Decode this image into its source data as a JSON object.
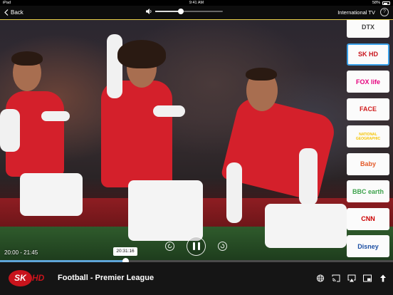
{
  "status_bar": {
    "left": "iPad",
    "time": "9:41 AM",
    "battery": "58%"
  },
  "top_bar": {
    "back_label": "Back",
    "volume_level": 0.38,
    "title": "International TV",
    "help_label": "?"
  },
  "player": {
    "elapsed_time": "20:00 - 21:45",
    "scrub_tooltip": "20:31:16",
    "progress": 0.32,
    "rewind_icon": "rewind-icon",
    "pause_icon": "pause-icon",
    "forward_icon": "forward-icon"
  },
  "channels": [
    {
      "name": "DTX",
      "color": "#444444"
    },
    {
      "name": "SK HD",
      "color": "#c8141c",
      "active": true
    },
    {
      "name": "FOX life",
      "color": "#e6007e"
    },
    {
      "name": "FACE",
      "color": "#d01d1d"
    },
    {
      "name": "NATIONAL GEOGRAPHIC",
      "color": "#f5c400"
    },
    {
      "name": "Baby",
      "color": "#e45b2a"
    },
    {
      "name": "BBC earth",
      "color": "#3fa34d"
    },
    {
      "name": "CNN",
      "color": "#cc0000"
    },
    {
      "name": "Disney",
      "color": "#1c4fa3"
    }
  ],
  "bottom_bar": {
    "logo_sk": "SK",
    "logo_hd": "HD",
    "program_title": "Football - Premier League",
    "icons": [
      "globe-icon",
      "cast-icon",
      "airplay-icon",
      "pip-icon",
      "share-icon"
    ]
  }
}
